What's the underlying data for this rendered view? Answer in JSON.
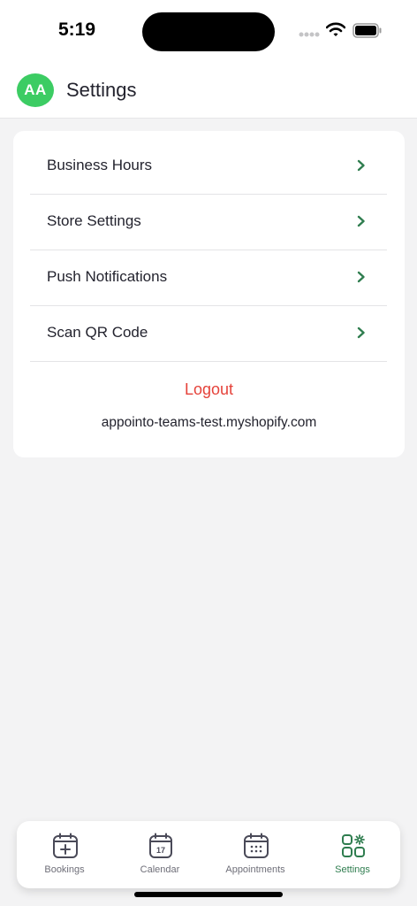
{
  "status_bar": {
    "time": "5:19"
  },
  "header": {
    "avatar_initials": "AA",
    "title": "Settings"
  },
  "settings_menu": {
    "items": [
      {
        "label": "Business Hours"
      },
      {
        "label": "Store Settings"
      },
      {
        "label": "Push Notifications"
      },
      {
        "label": "Scan QR Code"
      }
    ],
    "logout_label": "Logout",
    "shop_domain": "appointo-teams-test.myshopify.com"
  },
  "tabbar": {
    "tabs": [
      {
        "label": "Bookings",
        "icon": "calendar-plus-icon"
      },
      {
        "label": "Calendar",
        "icon": "calendar-17-icon"
      },
      {
        "label": "Appointments",
        "icon": "calendar-dots-icon"
      },
      {
        "label": "Settings",
        "icon": "grid-gear-icon",
        "active": true
      }
    ]
  },
  "colors": {
    "accent": "#2f7d4f",
    "avatar": "#3ccc63",
    "logout": "#e5423a",
    "background": "#f3f3f4"
  }
}
